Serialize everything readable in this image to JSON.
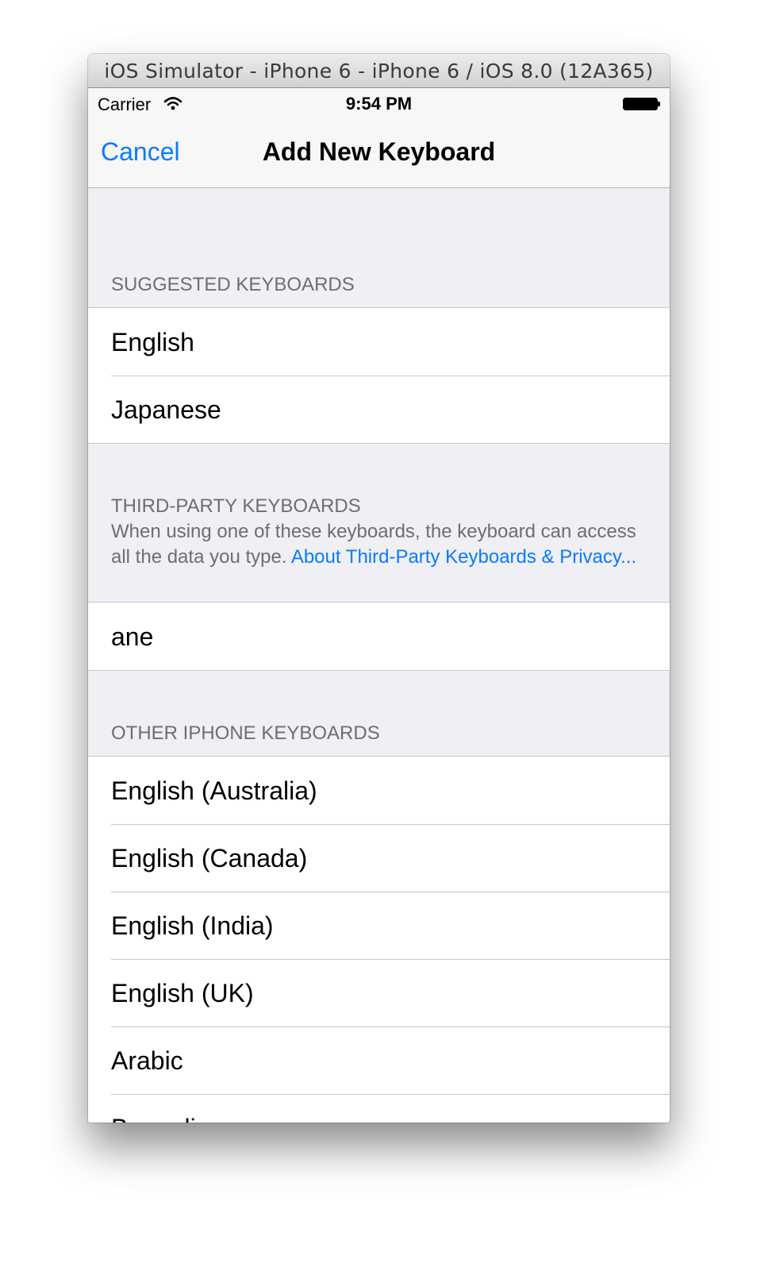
{
  "window": {
    "title": "iOS Simulator - iPhone 6 - iPhone 6 / iOS 8.0 (12A365)"
  },
  "status_bar": {
    "carrier": "Carrier",
    "time": "9:54 PM",
    "wifi_icon": "wifi-icon",
    "battery_icon": "battery-icon"
  },
  "nav": {
    "cancel_label": "Cancel",
    "title": "Add New Keyboard"
  },
  "colors": {
    "accent": "#0a7aff",
    "grouped_background": "#efeff4",
    "section_text": "#6d6d72",
    "separator": "#c8c7cc"
  },
  "sections": {
    "suggested": {
      "header": "SUGGESTED KEYBOARDS",
      "items": [
        "English",
        "Japanese"
      ]
    },
    "third_party": {
      "header": "THIRD-PARTY KEYBOARDS",
      "description": "When using one of these keyboards, the keyboard can access all the data you type.",
      "link_label": "About Third-Party Keyboards & Privacy...",
      "items": [
        "ane"
      ]
    },
    "other": {
      "header": "OTHER IPHONE KEYBOARDS",
      "items": [
        "English (Australia)",
        "English (Canada)",
        "English (India)",
        "English (UK)",
        "Arabic",
        "Bengali"
      ]
    }
  }
}
